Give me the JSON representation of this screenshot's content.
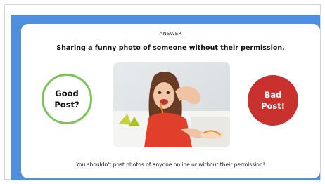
{
  "answer_label": "ANSWER",
  "question": "Sharing a funny photo of someone without their permission.",
  "good_button": {
    "label": "Good\nPost?"
  },
  "bad_button": {
    "label": "Bad\nPost!"
  },
  "photo": {
    "subject": "woman-eating-pasta-funny-face"
  },
  "footer": "You shouldn't post photos of anyone online or without their permission!",
  "colors": {
    "panel": "#4f8fde",
    "good_border": "#7cc35a",
    "bad_fill": "#c9312f"
  }
}
